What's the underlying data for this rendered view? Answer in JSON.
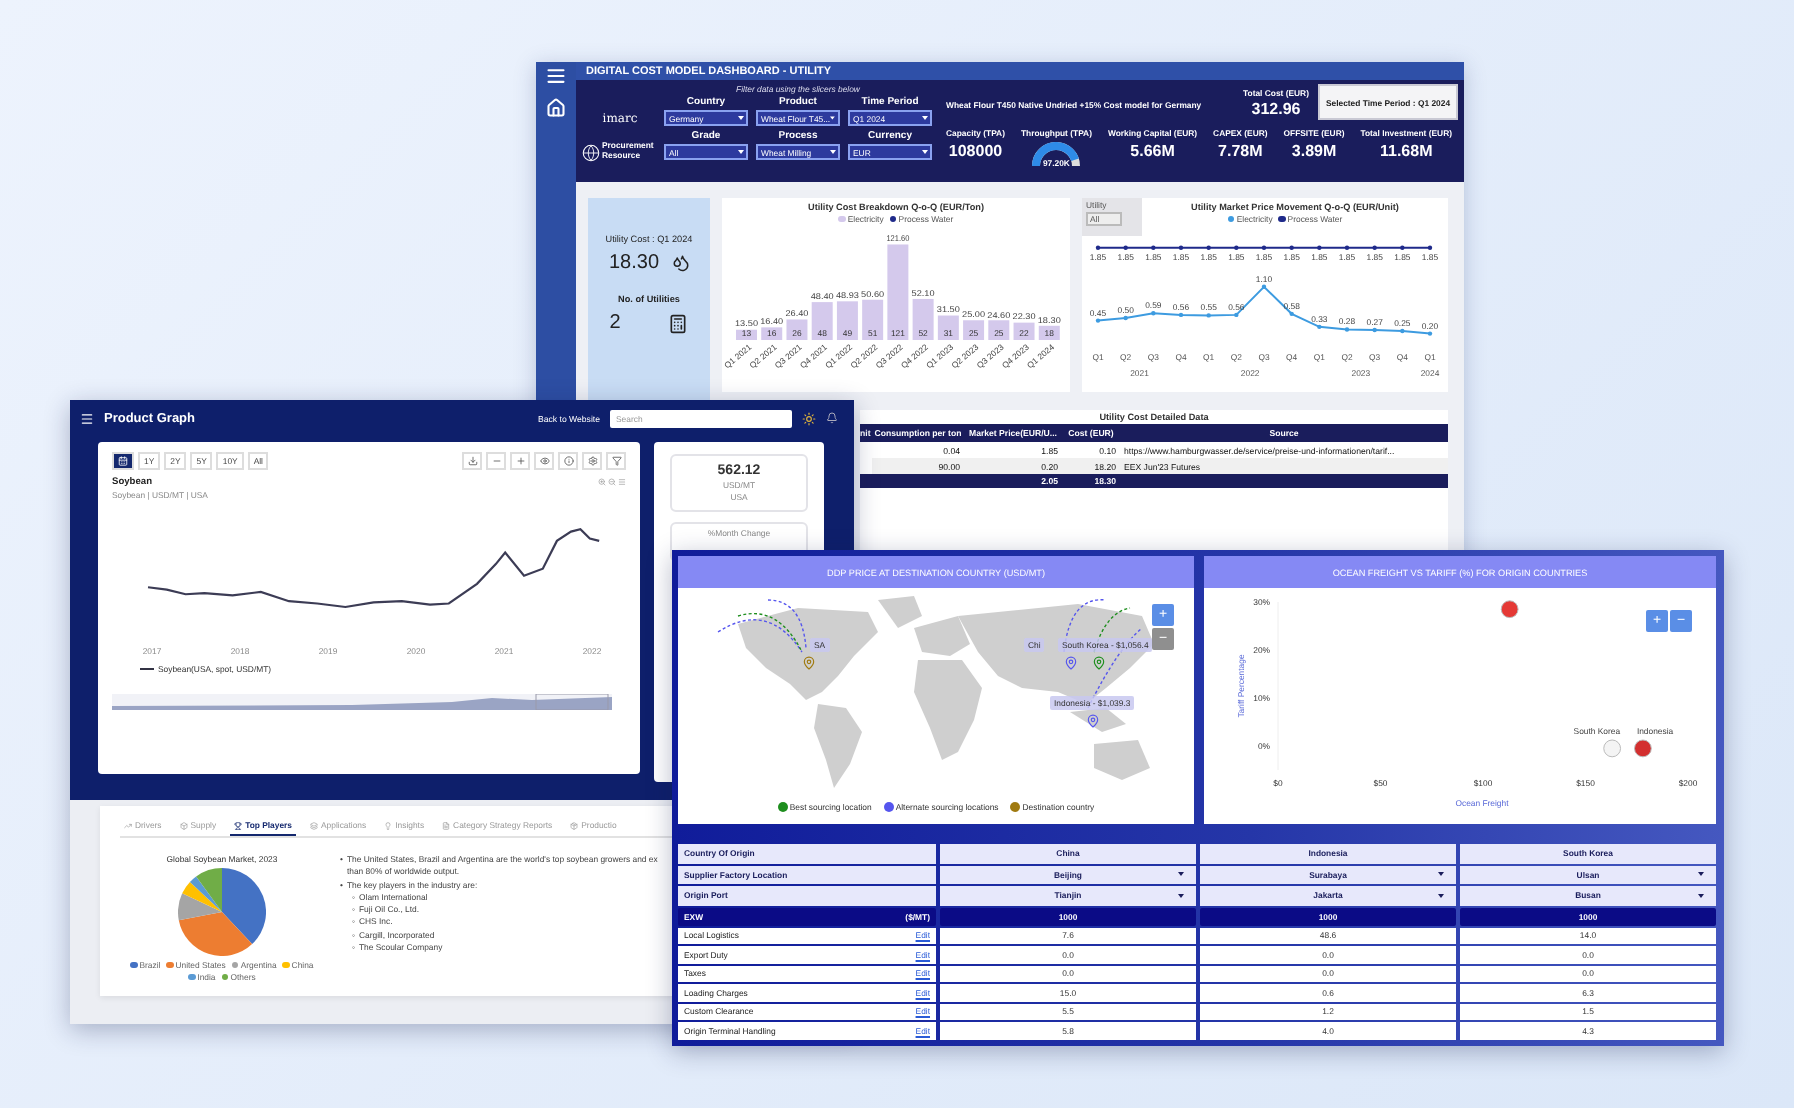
{
  "utility_dashboard": {
    "title": "DIGITAL COST MODEL DASHBOARD - UTILITY",
    "filter_hint": "Filter data using the slicers below",
    "logos": [
      "imarc",
      "Procurement Resource"
    ],
    "filters": [
      {
        "label": "Country",
        "value": "Germany"
      },
      {
        "label": "Product",
        "value": "Wheat Flour T45..."
      },
      {
        "label": "Time Period",
        "value": "Q1 2024"
      },
      {
        "label": "Grade",
        "value": "All"
      },
      {
        "label": "Process",
        "value": "Wheat Milling"
      },
      {
        "label": "Currency",
        "value": "EUR"
      }
    ],
    "model_title": "Wheat Flour T450 Native Undried +15% Cost model for Germany",
    "total_cost": {
      "label": "Total Cost (EUR)",
      "value": "312.96"
    },
    "period_button": "Selected Time Period : Q1 2024",
    "kpis": [
      {
        "kind": "number",
        "label": "Capacity (TPA)",
        "value": "108000"
      },
      {
        "kind": "gauge",
        "label": "Throughput (TPA)",
        "value": "97.20K"
      },
      {
        "kind": "number",
        "label": "Working Capital (EUR)",
        "value": "5.66M"
      },
      {
        "kind": "number",
        "label": "CAPEX (EUR)",
        "value": "7.78M"
      },
      {
        "kind": "number",
        "label": "OFFSITE (EUR)",
        "value": "3.89M"
      },
      {
        "kind": "number",
        "label": "Total Investment (EUR)",
        "value": "11.68M"
      }
    ],
    "utility_card": {
      "title": "Utility Cost : Q1 2024",
      "cost": "18.30",
      "count_label": "No. of Utilities",
      "count": "2"
    },
    "bar_chart": {
      "chart_data": {
        "type": "bar",
        "title": "Utility Cost Breakdown Q-o-Q (EUR/Ton)",
        "stacked": true,
        "categories": [
          "Q1 2021",
          "Q2 2021",
          "Q3 2021",
          "Q4 2021",
          "Q1 2022",
          "Q2 2022",
          "Q3 2022",
          "Q4 2022",
          "Q1 2023",
          "Q2 2023",
          "Q3 2023",
          "Q4 2023",
          "Q1 2024"
        ],
        "series": [
          {
            "name": "Electricity",
            "color": "#d4c9ec",
            "values": [
              13,
              16,
              26,
              48,
              49,
              51,
              121,
              52,
              31,
              25,
              25,
              22,
              18
            ]
          },
          {
            "name": "Process Water",
            "color": "#1f2a8a",
            "values": [
              null,
              null,
              null,
              null,
              null,
              null,
              null,
              null,
              null,
              null,
              null,
              null,
              null
            ]
          }
        ],
        "data_labels": true,
        "annotations": [
          {
            "x": "Q1 2021",
            "y": 13.5,
            "text": "13.50"
          },
          {
            "x": "Q2 2021",
            "y": 16.4,
            "text": "16.40"
          },
          {
            "x": "Q3 2021",
            "y": 26.4,
            "text": "26.40"
          },
          {
            "x": "Q4 2021",
            "y": 48.4,
            "text": "48.40"
          },
          {
            "x": "Q1 2022",
            "y": 48.93,
            "text": "48.93"
          },
          {
            "x": "Q2 2022",
            "y": 50.6,
            "text": "50.60"
          },
          {
            "x": "Q3 2022",
            "y": 121.6,
            "text": "121.60"
          },
          {
            "x": "Q4 2022",
            "y": 52.1,
            "text": "52.10"
          },
          {
            "x": "Q1 2023",
            "y": 31.5,
            "text": "31.50"
          },
          {
            "x": "Q2 2023",
            "y": 25.0,
            "text": "25.00"
          },
          {
            "x": "Q3 2023",
            "y": 24.6,
            "text": "24.60"
          },
          {
            "x": "Q4 2023",
            "y": 22.3,
            "text": "22.30"
          },
          {
            "x": "Q1 2024",
            "y": 18.3,
            "text": "18.30"
          }
        ]
      }
    },
    "line_chart": {
      "filter": {
        "label": "Utility",
        "value": "All"
      },
      "year_labels": [
        "2021",
        "2022",
        "2023",
        "2024"
      ],
      "chart_data": {
        "type": "line",
        "title": "Utility Market Price Movement Q-o-Q (EUR/Unit)",
        "categories": [
          "Q1",
          "Q2",
          "Q3",
          "Q4",
          "Q1",
          "Q2",
          "Q3",
          "Q4",
          "Q1",
          "Q2",
          "Q3",
          "Q4",
          "Q1"
        ],
        "series": [
          {
            "name": "Electricity",
            "color": "#3d9be0",
            "values": [
              0.45,
              0.5,
              0.59,
              0.56,
              0.55,
              0.56,
              1.1,
              0.58,
              0.33,
              0.28,
              0.27,
              0.25,
              0.2
            ],
            "value_labels": [
              "0.45",
              "0.50",
              "0.59",
              "0.56",
              "0.55",
              "0.56",
              "1.10",
              "0.58",
              "0.33",
              "0.28",
              "0.27",
              "0.25",
              "0.20"
            ]
          },
          {
            "name": "Process Water",
            "color": "#1f2a8a",
            "values": [
              1.85,
              1.85,
              1.85,
              1.85,
              1.85,
              1.85,
              1.85,
              1.85,
              1.85,
              1.85,
              1.85,
              1.85,
              1.85
            ],
            "value_labels": [
              "1.85",
              "1.85",
              "1.85",
              "1.85",
              "1.85",
              "1.85",
              "1.85",
              "1.85",
              "1.85",
              "1.85",
              "1.85",
              "1.85",
              "1.85"
            ]
          }
        ],
        "data_labels": true
      }
    },
    "detail_table": {
      "title": "Utility Cost Detailed Data",
      "columns": [
        "nit",
        "Consumption per ton",
        "Market Price(EUR/U...",
        "Cost (EUR)",
        "Source"
      ],
      "rows": [
        {
          "consumption": "0.04",
          "market_price": "1.85",
          "cost": "0.10",
          "source": "https://www.hamburgwasser.de/service/preise-und-informationen/tarif..."
        },
        {
          "consumption": "90.00",
          "market_price": "0.20",
          "cost": "18.20",
          "source": "EEX Jun'23 Futures"
        }
      ],
      "total": {
        "market_price": "2.05",
        "cost": "18.30"
      }
    }
  },
  "product_graph": {
    "title": "Product Graph",
    "back_link": "Back to Website",
    "search": {
      "placeholder": "Search"
    },
    "ranges": [
      {
        "kind": "icon",
        "selected": true
      },
      {
        "kind": "text",
        "label": "1Y",
        "selected": false
      },
      {
        "kind": "text",
        "label": "2Y",
        "selected": false
      },
      {
        "kind": "text",
        "label": "5Y",
        "selected": false
      },
      {
        "kind": "text",
        "label": "10Y",
        "selected": false
      },
      {
        "kind": "text",
        "label": "All",
        "selected": false
      }
    ],
    "chart_title": "Soybean",
    "chart_subtitle": "Soybean | USD/MT | USA",
    "x_labels": [
      "2017",
      "2018",
      "2019",
      "2020",
      "2021",
      "2022"
    ],
    "legend": "Soybean(USA, spot, USD/MT)",
    "price_card": {
      "value": "562.12",
      "unit": "USD/MT",
      "region": "USA"
    },
    "change_card": {
      "label": "%Month Change"
    },
    "tabs": [
      {
        "label": "Drivers",
        "selected": false
      },
      {
        "label": "Supply",
        "selected": false
      },
      {
        "label": "Top Players",
        "selected": true
      },
      {
        "label": "Applications",
        "selected": false
      },
      {
        "label": "Insights",
        "selected": false
      },
      {
        "label": "Category Strategy Reports",
        "selected": false
      },
      {
        "label": "Productio",
        "selected": false
      }
    ],
    "pie_title": "Global Soybean Market, 2023",
    "pie_legend": [
      {
        "name": "Brazil",
        "color": "#4472c4"
      },
      {
        "name": "United States",
        "color": "#ed7d31"
      },
      {
        "name": "Argentina",
        "color": "#a5a5a5"
      },
      {
        "name": "China",
        "color": "#ffc000"
      },
      {
        "name": "India",
        "color": "#5b9bd5"
      },
      {
        "name": "Others",
        "color": "#70ad47"
      }
    ],
    "bullets": [
      {
        "marker": "•",
        "text": "The United States, Brazil and Argentina are the world's top soybean growers and ex\nthan 80% of worldwide output."
      },
      {
        "marker": "•",
        "text": "The key players in the industry are:",
        "children": [
          {
            "marker": "◦",
            "text": "Olam International"
          },
          {
            "marker": "◦",
            "text": "Fuji Oil Co., Ltd."
          },
          {
            "marker": "◦",
            "text": "CHS Inc."
          },
          {
            "marker": "◦",
            "text": "Cargill, Incorporated"
          },
          {
            "marker": "◦",
            "text": "The Scoular Company"
          }
        ]
      }
    ]
  },
  "cost_comparison": {
    "map_panel": {
      "title": "DDP PRICE AT DESTINATION COUNTRY (USD/MT)",
      "zoom_in": "+",
      "zoom_out": "−",
      "markers": [
        {
          "kind": "destination",
          "label": "SA"
        },
        {
          "kind": "alternate",
          "label": "Chi"
        },
        {
          "kind": "best",
          "label": "South Korea - $1,056.4"
        },
        {
          "kind": "alternate",
          "label": "Indonesia - $1,039.3"
        }
      ],
      "legend": [
        {
          "kind": "best",
          "label": "Best sourcing location",
          "color": "#1e8e1e"
        },
        {
          "kind": "alternate",
          "label": "Alternate sourcing locations",
          "color": "#5555ee"
        },
        {
          "kind": "destination",
          "label": "Destination country",
          "color": "#a07a10"
        }
      ]
    },
    "scatter_panel": {
      "title": "OCEAN FREIGHT VS TARIFF (%) FOR ORIGIN COUNTRIES",
      "zoom_in": "+",
      "zoom_out": "−",
      "chart_data": {
        "type": "scatter",
        "xlabel": "Ocean Freight",
        "ylabel": "Tariff Percentage",
        "xlim": [
          0,
          200
        ],
        "ylim": [
          -5,
          30
        ],
        "xticks": [
          {
            "value": 0,
            "label": "$0"
          },
          {
            "value": 50,
            "label": "$50"
          },
          {
            "value": 100,
            "label": "$100"
          },
          {
            "value": 150,
            "label": "$150"
          },
          {
            "value": 200,
            "label": "$200"
          }
        ],
        "yticks": [
          {
            "value": 0,
            "label": "0%"
          },
          {
            "value": 10,
            "label": "10%"
          },
          {
            "value": 20,
            "label": "20%"
          },
          {
            "value": 30,
            "label": "30%"
          }
        ],
        "series": [
          {
            "color": "#e53935",
            "x": [
              113
            ],
            "values": [
              28.5
            ]
          },
          {
            "color": "#f4f4f4",
            "x": [
              163
            ],
            "values": [
              -0.5
            ]
          },
          {
            "color": "#d32f2f",
            "x": [
              178
            ],
            "values": [
              -0.5
            ]
          }
        ],
        "annotations": [
          "South Korea",
          "Indonesia"
        ]
      }
    },
    "table": {
      "origin_label": "Country Of Origin",
      "countries": [
        "China",
        "Indonesia",
        "South Korea"
      ],
      "selectors": [
        {
          "label": "Supplier Factory Location",
          "values": [
            "Beijing",
            "Surabaya",
            "Ulsan"
          ]
        },
        {
          "label": "Origin Port",
          "values": [
            "Tianjin",
            "Jakarta",
            "Busan"
          ]
        }
      ],
      "exw": {
        "label": "EXW",
        "unit": "($/MT)",
        "values": [
          "1000",
          "1000",
          "1000"
        ]
      },
      "rows": [
        {
          "label": "Local Logistics",
          "edit": "Edit",
          "values": [
            "7.6",
            "48.6",
            "14.0"
          ]
        },
        {
          "label": "Export Duty",
          "edit": "Edit",
          "values": [
            "0.0",
            "0.0",
            "0.0"
          ]
        },
        {
          "label": "Taxes",
          "edit": "Edit",
          "values": [
            "0.0",
            "0.0",
            "0.0"
          ]
        },
        {
          "label": "Loading Charges",
          "edit": "Edit",
          "values": [
            "15.0",
            "0.6",
            "6.3"
          ]
        },
        {
          "label": "Custom Clearance",
          "edit": "Edit",
          "values": [
            "5.5",
            "1.2",
            "1.5"
          ]
        },
        {
          "label": "Origin Terminal Handling",
          "edit": "Edit",
          "values": [
            "5.8",
            "4.0",
            "4.3"
          ]
        }
      ]
    }
  }
}
